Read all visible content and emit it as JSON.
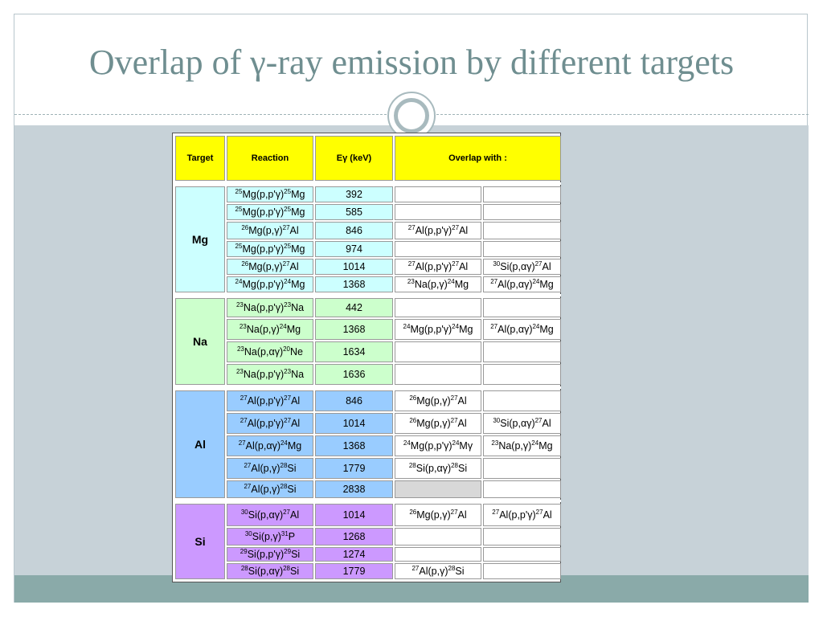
{
  "title": "Overlap of γ-ray emission by different targets",
  "colors": {
    "title": "#6f8e90",
    "header": "#ffff00",
    "mg_group": "#ccffff",
    "na_group": "#ccffcc",
    "al_group": "#99ccff",
    "si_group": "#cc99ff",
    "band": "#c7d2d8",
    "bottom_band": "#8aaaa9"
  },
  "table": {
    "headers": {
      "target": "Target",
      "reaction": "Reaction",
      "energy": "Eγ (keV)",
      "overlap": "Overlap with :"
    },
    "groups": [
      {
        "target": "Mg",
        "cls": "mg",
        "rows": [
          {
            "h": 20,
            "reaction": "25Mg(p,p'γ)25Mg",
            "energy": "392",
            "o1": "",
            "o2": ""
          },
          {
            "h": 20,
            "reaction": "25Mg(p,p'γ)25Mg",
            "energy": "585",
            "o1": "",
            "o2": ""
          },
          {
            "h": 22,
            "reaction": "26Mg(p,γ)27Al",
            "energy": "846",
            "o1": "27Al(p,p'γ)27Al",
            "o2": ""
          },
          {
            "h": 20,
            "reaction": "25Mg(p,p'γ)25Mg",
            "energy": "974",
            "o1": "",
            "o2": ""
          },
          {
            "h": 20,
            "reaction": "26Mg(p,γ)27Al",
            "energy": "1014",
            "o1": "27Al(p,p'γ)27Al",
            "o2": "30Si(p,αγ)27Al"
          },
          {
            "h": 20,
            "reaction": "24Mg(p,p'γ)24Mg",
            "energy": "1368",
            "o1": "23Na(p,γ)24Mg",
            "o2": "27Al(p,αγ)24Mg"
          }
        ]
      },
      {
        "target": "Na",
        "cls": "na",
        "rows": [
          {
            "h": 24,
            "reaction": "23Na(p,p'γ)23Na",
            "energy": "442",
            "o1": "",
            "o2": ""
          },
          {
            "h": 26,
            "reaction": "23Na(p,γ)24Mg",
            "energy": "1368",
            "o1": "24Mg(p,p'γ)24Mg",
            "o2": "27Al(p,αγ)24Mg"
          },
          {
            "h": 26,
            "reaction": "23Na(p,αγ)20Ne",
            "energy": "1634",
            "o1": "",
            "o2": ""
          },
          {
            "h": 26,
            "reaction": "23Na(p,p'γ)23Na",
            "energy": "1636",
            "o1": "",
            "o2": ""
          }
        ]
      },
      {
        "target": "Al",
        "cls": "al",
        "rows": [
          {
            "h": 26,
            "reaction": "27Al(p,p'γ)27Al",
            "energy": "846",
            "o1": "26Mg(p,γ)27Al",
            "o2": ""
          },
          {
            "h": 26,
            "reaction": "27Al(p,p'γ)27Al",
            "energy": "1014",
            "o1": "26Mg(p,γ)27Al",
            "o2": "30Si(p,αγ)27Al"
          },
          {
            "h": 26,
            "reaction": "27Al(p,αγ)24Mg",
            "energy": "1368",
            "o1": "24Mg(p,p'γ)24Mγ",
            "o2": "23Na(p,γ)24Mg"
          },
          {
            "h": 26,
            "reaction": "27Al(p,γ)28Si",
            "energy": "1779",
            "o1": "28Si(p,αγ)28Si",
            "o2": ""
          },
          {
            "h": 22,
            "reaction": "27Al(p,γ)28Si",
            "energy": "2838",
            "o1": "",
            "o2": "",
            "gray1": true
          }
        ]
      },
      {
        "target": "Si",
        "cls": "si",
        "rows": [
          {
            "h": 28,
            "reaction": "30Si(p,αγ)27Al",
            "energy": "1014",
            "o1": "26Mg(p,γ)27Al",
            "o2": "27Al(p,p'γ)27Al"
          },
          {
            "h": 22,
            "reaction": "30Si(p,γ)31P",
            "energy": "1268",
            "o1": "",
            "o2": ""
          },
          {
            "h": 18,
            "reaction": "29Si(p,p'γ)29Si",
            "energy": "1274",
            "o1": "",
            "o2": ""
          },
          {
            "h": 20,
            "reaction": "28Si(p,αγ)28Si",
            "energy": "1779",
            "o1": "27Al(p,γ)28Si",
            "o2": ""
          }
        ]
      }
    ]
  }
}
